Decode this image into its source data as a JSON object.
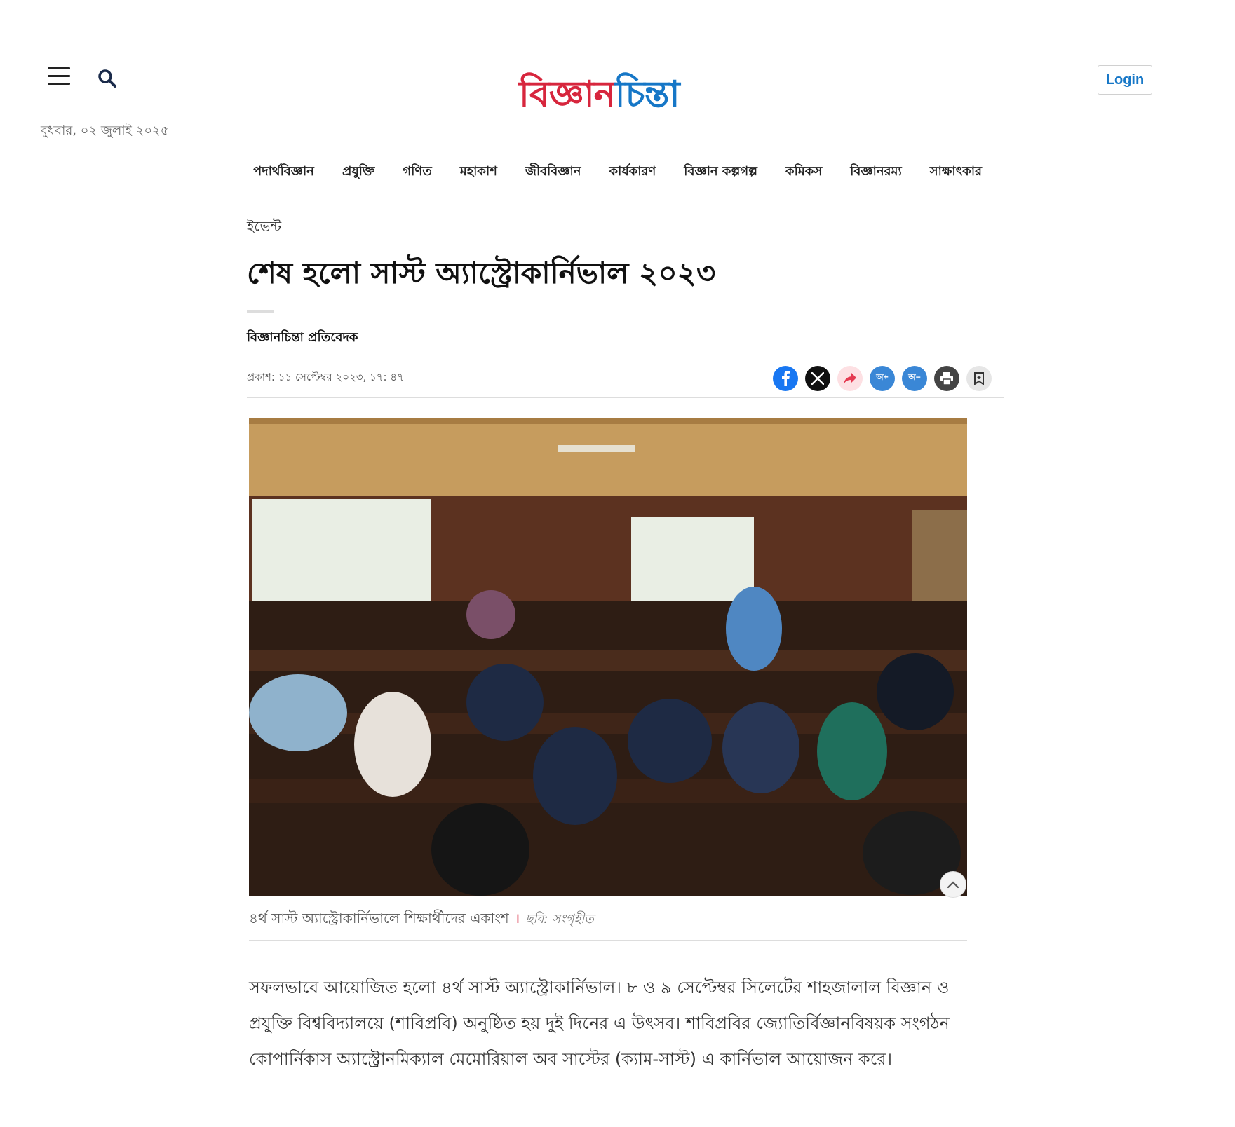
{
  "header": {
    "date": "বুধবার, ০২ জুলাই ২০২৫",
    "logo_part1": "বিজ্ঞান",
    "logo_part2": "চিন্তা",
    "login_label": "Login"
  },
  "nav": {
    "items": [
      {
        "label": "পদার্থবিজ্ঞান"
      },
      {
        "label": "প্রযুক্তি"
      },
      {
        "label": "গণিত"
      },
      {
        "label": "মহাকাশ"
      },
      {
        "label": "জীববিজ্ঞান"
      },
      {
        "label": "কার্যকারণ"
      },
      {
        "label": "বিজ্ঞান কল্পগল্প"
      },
      {
        "label": "কমিকস"
      },
      {
        "label": "বিজ্ঞানরম্য"
      },
      {
        "label": "সাক্ষাৎকার"
      }
    ]
  },
  "article": {
    "category": "ইভেন্ট",
    "title": "শেষ হলো সাস্ট অ্যাস্ট্রোকার্নিভাল ২০২৩",
    "author": "বিজ্ঞানচিন্তা প্রতিবেদক",
    "published": "প্রকাশ: ১১ সেপ্টেম্বর ২০২৩, ১৭: ৪৭",
    "font_increase": "অ+",
    "font_decrease": "অ−",
    "caption": "৪র্থ সাস্ট অ্যাস্ট্রোকার্নিভালে শিক্ষার্থীদের একাংশ",
    "caption_sep": "।",
    "caption_credit": "ছবি: সংগৃহীত",
    "body": "সফলভাবে আয়োজিত হলো ৪র্থ সাস্ট অ্যাস্ট্রোকার্নিভাল। ৮ ও ৯ সেপ্টেম্বর সিলেটের শাহজালাল বিজ্ঞান ও প্রযুক্তি বিশ্ববিদ্যালয়ে (শাবিপ্রবি) অনুষ্ঠিত হয় দুই দিনের এ উৎসব। শাবিপ্রবির জ্যোতির্বিজ্ঞানবিষয়ক সংগঠন কোপার্নিকাস অ্যাস্ট্রোনমিক্যাল মেমোরিয়াল অব সাস্টের (ক্যাম-সাস্ট) এ কার্নিভাল আয়োজন করে।"
  },
  "icons": {
    "menu": "hamburger-icon",
    "search": "search-icon",
    "facebook": "facebook-icon",
    "x": "x-icon",
    "share": "share-icon",
    "print": "print-icon",
    "bookmark": "bookmark-icon",
    "scroll": "chevron-up-icon"
  },
  "colors": {
    "brand_red": "#d7263d",
    "brand_blue": "#1677c7",
    "facebook": "#1877f2"
  }
}
